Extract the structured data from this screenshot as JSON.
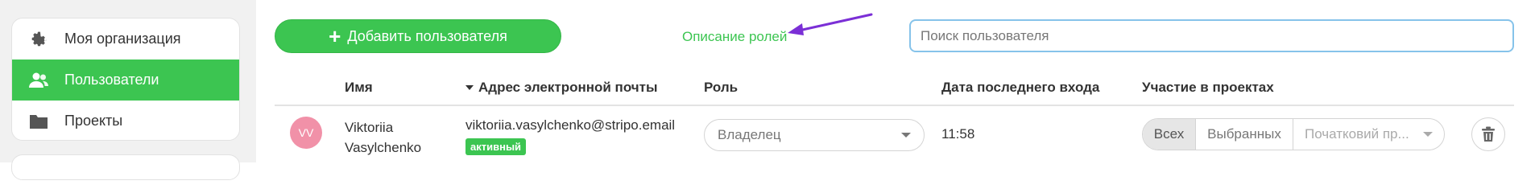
{
  "sidebar": {
    "items": [
      {
        "label": "Моя организация",
        "icon": "gear-icon"
      },
      {
        "label": "Пользователи",
        "icon": "users-icon",
        "active": true
      },
      {
        "label": "Проекты",
        "icon": "folder-icon"
      }
    ]
  },
  "toolbar": {
    "add_user_label": "Добавить пользователя",
    "roles_link": "Описание ролей",
    "search_placeholder": "Поиск пользователя"
  },
  "table": {
    "columns": {
      "name": "Имя",
      "email": "Адрес электронной почты",
      "role": "Роль",
      "last_login": "Дата последнего входа",
      "projects": "Участие в проектах"
    },
    "rows": [
      {
        "initials": "VV",
        "first_name": "Viktoriia",
        "last_name": "Vasylchenko",
        "email": "viktoriia.vasylchenko@stripo.email",
        "status": "активный",
        "role": "Владелец",
        "last_login": "11:58",
        "projects_all": "Всех",
        "projects_selected": "Выбранных",
        "projects_dropdown": "Початковий пр..."
      }
    ]
  },
  "colors": {
    "accent": "#3cc551",
    "annotation_arrow": "#7b2fd6",
    "avatar": "#f191a8",
    "search_border": "#86c3ea"
  }
}
